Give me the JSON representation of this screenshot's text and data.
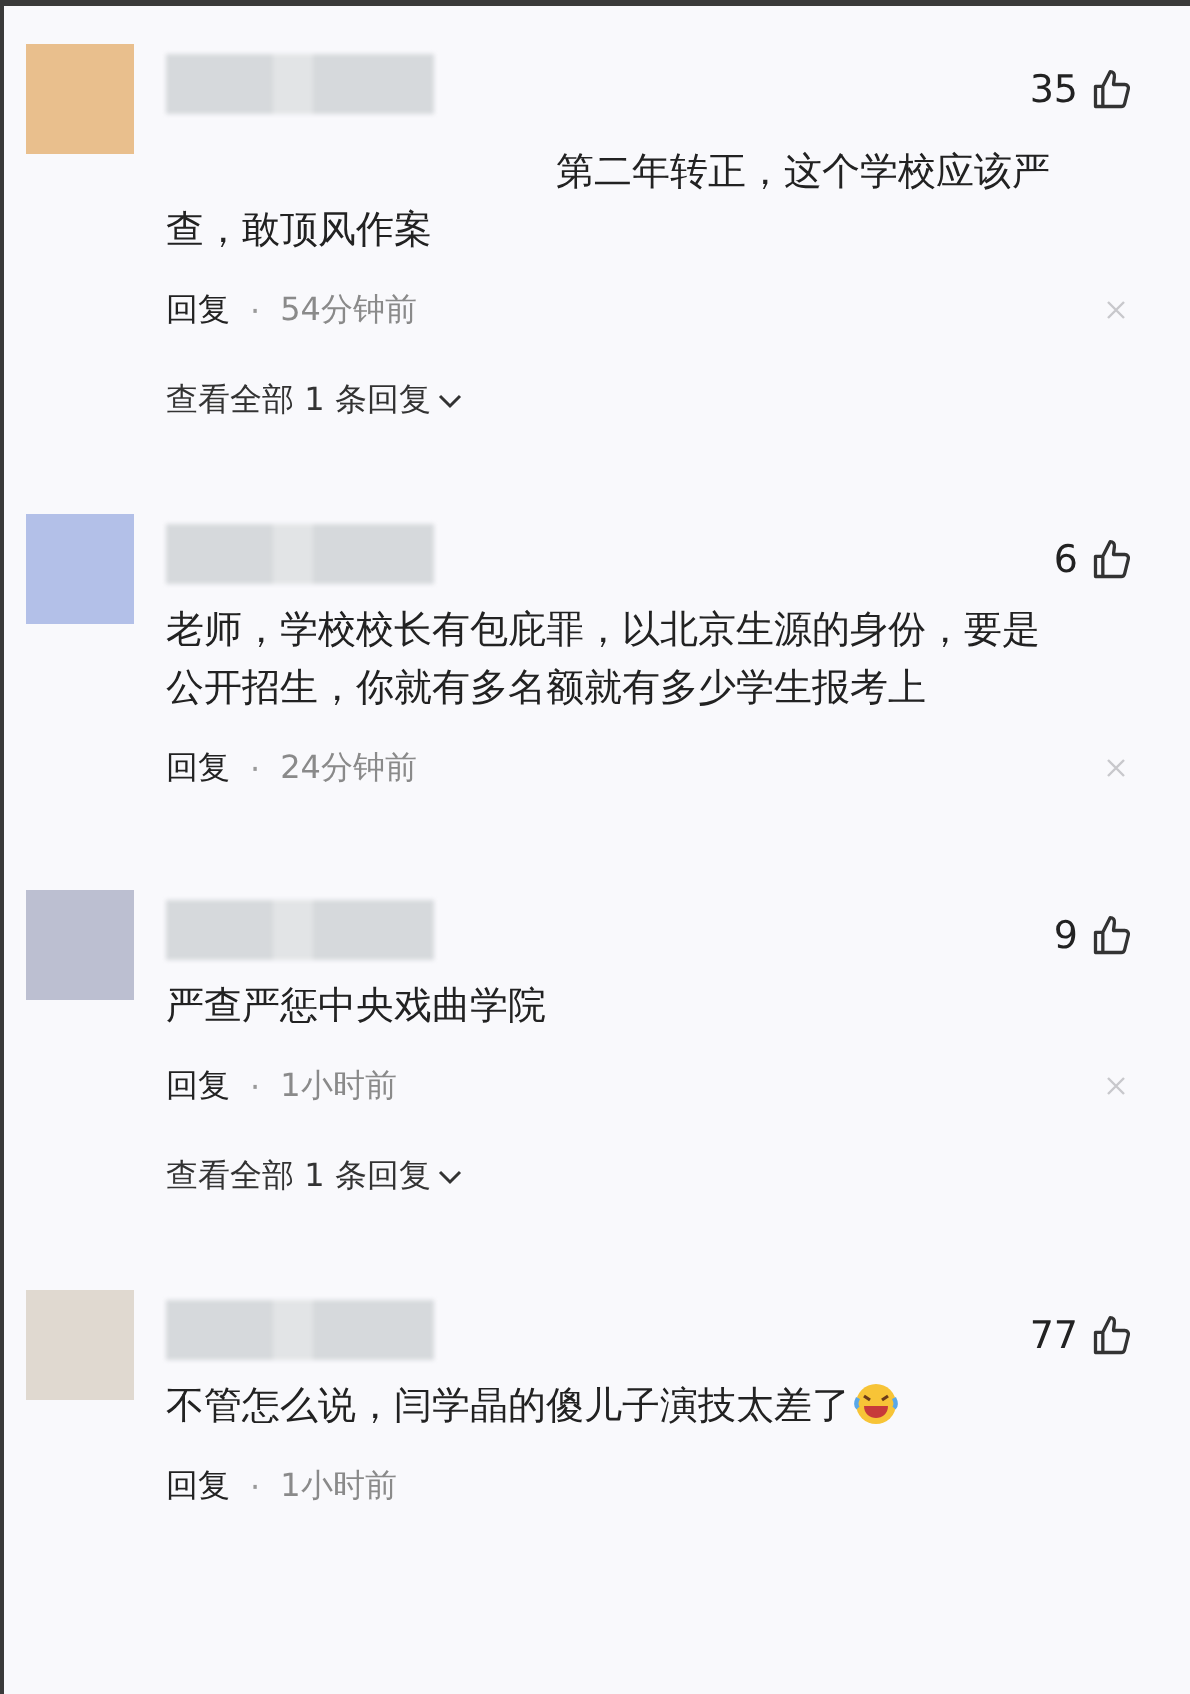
{
  "comments": [
    {
      "color": "#e9bf8d",
      "likes": "35",
      "text": "第二年转正，这个学校应该严查，敢顶风作案",
      "blurred_start": true,
      "trailing_emoji": false,
      "reply_label": "回复",
      "separator": "·",
      "time": "54分钟前",
      "dismissable": true,
      "view_replies": "查看全部 1 条回复"
    },
    {
      "color": "#b3c0e8",
      "likes": "6",
      "text": "老师，学校校长有包庇罪，以北京生源的身份，要是公开招生，你就有多名额就有多少学生报考上",
      "blurred_start": false,
      "trailing_emoji": false,
      "reply_label": "回复",
      "separator": "·",
      "time": "24分钟前",
      "dismissable": true
    },
    {
      "color": "#bcbfd1",
      "likes": "9",
      "text": "严查严惩中央戏曲学院",
      "blurred_start": false,
      "trailing_emoji": false,
      "reply_label": "回复",
      "separator": "·",
      "time": "1小时前",
      "dismissable": true,
      "view_replies": "查看全部 1 条回复"
    },
    {
      "color": "#e0d9d0",
      "likes": "77",
      "text": "不管怎么说，闫学晶的傻儿子演技太差了",
      "blurred_start": false,
      "trailing_emoji": true,
      "reply_label": "回复",
      "separator": "·",
      "time": "1小时前",
      "dismissable": false
    }
  ]
}
